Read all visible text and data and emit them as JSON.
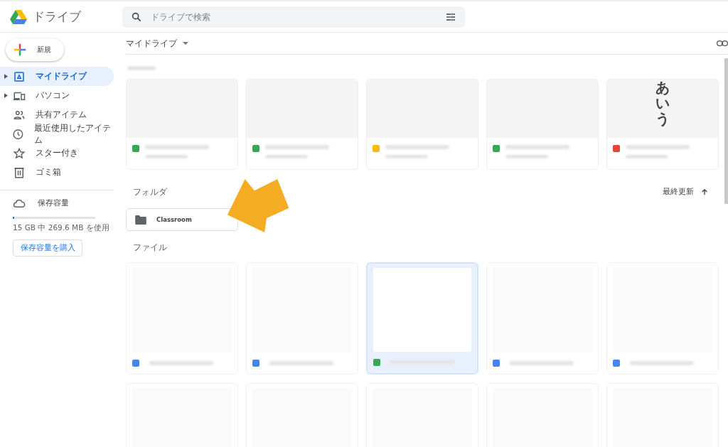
{
  "header": {
    "app_name": "ドライブ",
    "search": {
      "placeholder": "ドライブで検索"
    }
  },
  "sidebar": {
    "new_button": "新規",
    "items": [
      {
        "label": "マイドライブ",
        "expandable": true,
        "selected": true
      },
      {
        "label": "パソコン",
        "expandable": true,
        "selected": false
      },
      {
        "label": "共有アイテム",
        "expandable": false,
        "selected": false
      },
      {
        "label": "最近使用したアイテム",
        "expandable": false,
        "selected": false
      },
      {
        "label": "スター付き",
        "expandable": false,
        "selected": false
      },
      {
        "label": "ゴミ箱",
        "expandable": false,
        "selected": false
      }
    ],
    "storage": {
      "label": "保存容量",
      "level": 0.02,
      "usage": "15 GB 中 269.6 MB を使用",
      "buy_button": "保存容量を購入"
    }
  },
  "main": {
    "title": "マイドライブ",
    "quick_access": [
      {
        "color": "#34a853"
      },
      {
        "color": "#34a853"
      },
      {
        "color": "#fbbc04"
      },
      {
        "color": "#34a853"
      },
      {
        "color": "#ea4335",
        "thumbnail_text": "あいう"
      }
    ],
    "folders_heading": "フォルダ",
    "sort": {
      "label": "最終更新"
    },
    "folders": [
      {
        "name": "Classroom"
      }
    ],
    "files_heading": "ファイル",
    "files": [
      {
        "color": "#4285f4",
        "selected": false
      },
      {
        "color": "#4285f4",
        "selected": false
      },
      {
        "color": "#34a853",
        "selected": true
      },
      {
        "color": "#4285f4",
        "selected": false
      },
      {
        "color": "#4285f4",
        "selected": false
      },
      {
        "selected": false
      },
      {
        "selected": false
      },
      {
        "selected": false
      },
      {
        "selected": false
      },
      {
        "selected": false
      }
    ]
  }
}
